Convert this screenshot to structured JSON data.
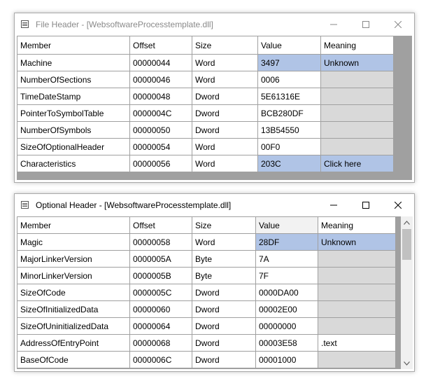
{
  "windows": {
    "file_header": {
      "title": "File Header - [WebsoftwareProcesstemplate.dll]",
      "columns": [
        "Member",
        "Offset",
        "Size",
        "Value",
        "Meaning"
      ],
      "rows": [
        {
          "member": "Machine",
          "offset": "00000044",
          "size": "Word",
          "value": "3497",
          "meaning": "Unknown"
        },
        {
          "member": "NumberOfSections",
          "offset": "00000046",
          "size": "Word",
          "value": "0006",
          "meaning": ""
        },
        {
          "member": "TimeDateStamp",
          "offset": "00000048",
          "size": "Dword",
          "value": "5E61316E",
          "meaning": ""
        },
        {
          "member": "PointerToSymbolTable",
          "offset": "0000004C",
          "size": "Dword",
          "value": "BCB280DF",
          "meaning": ""
        },
        {
          "member": "NumberOfSymbols",
          "offset": "00000050",
          "size": "Dword",
          "value": "13B54550",
          "meaning": ""
        },
        {
          "member": "SizeOfOptionalHeader",
          "offset": "00000054",
          "size": "Word",
          "value": "00F0",
          "meaning": ""
        },
        {
          "member": "Characteristics",
          "offset": "00000056",
          "size": "Word",
          "value": "203C",
          "meaning": "Click here"
        }
      ]
    },
    "optional_header": {
      "title": "Optional Header - [WebsoftwareProcesstemplate.dll]",
      "columns": [
        "Member",
        "Offset",
        "Size",
        "Value",
        "Meaning"
      ],
      "rows": [
        {
          "member": "Magic",
          "offset": "00000058",
          "size": "Word",
          "value": "28DF",
          "meaning": "Unknown"
        },
        {
          "member": "MajorLinkerVersion",
          "offset": "0000005A",
          "size": "Byte",
          "value": "7A",
          "meaning": ""
        },
        {
          "member": "MinorLinkerVersion",
          "offset": "0000005B",
          "size": "Byte",
          "value": "7F",
          "meaning": ""
        },
        {
          "member": "SizeOfCode",
          "offset": "0000005C",
          "size": "Dword",
          "value": "0000DA00",
          "meaning": ""
        },
        {
          "member": "SizeOfInitializedData",
          "offset": "00000060",
          "size": "Dword",
          "value": "00002E00",
          "meaning": ""
        },
        {
          "member": "SizeOfUninitializedData",
          "offset": "00000064",
          "size": "Dword",
          "value": "00000000",
          "meaning": ""
        },
        {
          "member": "AddressOfEntryPoint",
          "offset": "00000068",
          "size": "Dword",
          "value": "00003E58",
          "meaning": ".text"
        },
        {
          "member": "BaseOfCode",
          "offset": "0000006C",
          "size": "Dword",
          "value": "00001000",
          "meaning": ""
        }
      ]
    }
  },
  "icons": {
    "window_icon": "window-icon",
    "minimize": "minimize-icon",
    "maximize": "maximize-icon",
    "close": "close-icon",
    "scroll_up": "chevron-up-icon",
    "scroll_down": "chevron-down-icon"
  },
  "colors": {
    "highlight": "#b0c4e6",
    "meaning_gray": "#d9d9d9",
    "grid_background": "#a0a0a0"
  }
}
